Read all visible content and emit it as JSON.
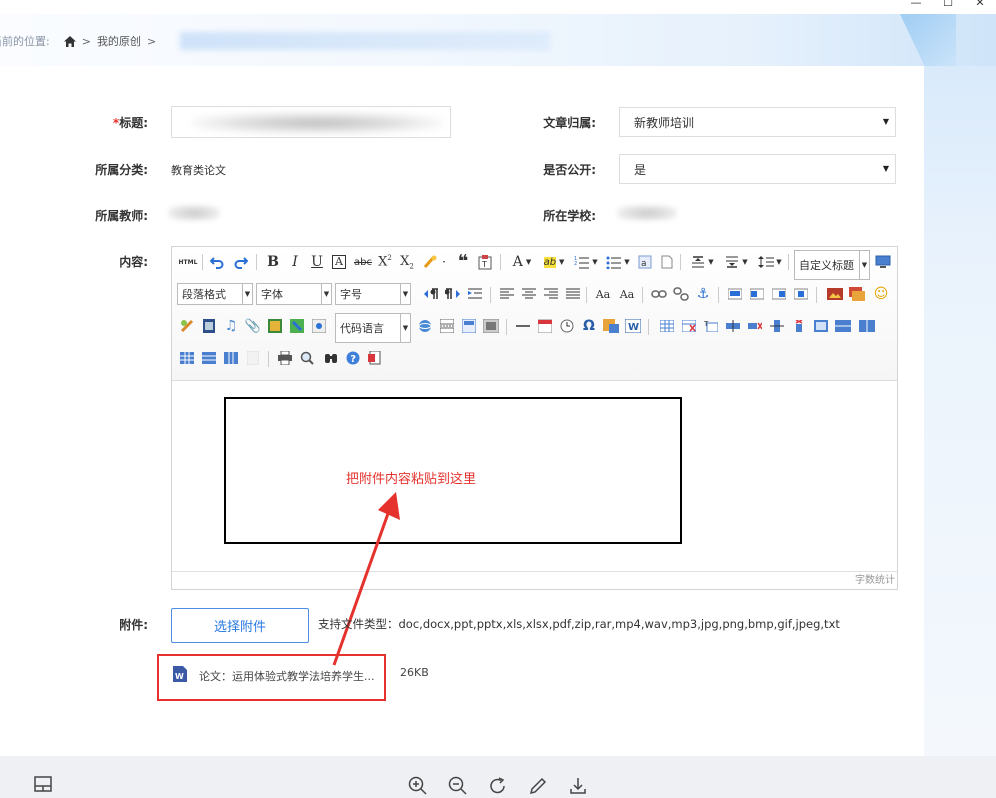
{
  "breadcrumb": {
    "label": "当前的位置:",
    "items": [
      "我的原创"
    ],
    "sep": ">"
  },
  "form": {
    "title_label": "标题:",
    "title_required_mark": "*",
    "category_label": "所属分类:",
    "category_value": "教育类论文",
    "teacher_label": "所属教师:",
    "belong_label": "文章归属:",
    "belong_value": "新教师培训",
    "public_label": "是否公开:",
    "public_value": "是",
    "school_label": "所在学校:",
    "content_label": "内容:",
    "attach_label": "附件:"
  },
  "editor": {
    "toolbar": {
      "custom_heading": "自定义标题",
      "paragraph": "段落格式",
      "font": "字体",
      "fontsize": "字号",
      "code_lang": "代码语言"
    },
    "wordcount": "字数统计"
  },
  "annotation": {
    "note": "把附件内容粘贴到这里"
  },
  "attachment": {
    "button": "选择附件",
    "types": "支持文件类型：doc,docx,ppt,pptx,xls,xlsx,pdf,zip,rar,mp4,wav,mp3,jpg,png,bmp,gif,jpeg,txt",
    "file_name": "论文：运用体验式教学法培养学生...",
    "file_size": "26KB"
  },
  "colors": {
    "accent": "#2a7ae2",
    "annotation_red": "#e5322d",
    "border": "#dddddd"
  },
  "icons": {
    "bottom": [
      "panel-icon",
      "zoom-in-icon",
      "zoom-out-icon",
      "rotate-icon",
      "edit-icon",
      "download-icon"
    ]
  }
}
